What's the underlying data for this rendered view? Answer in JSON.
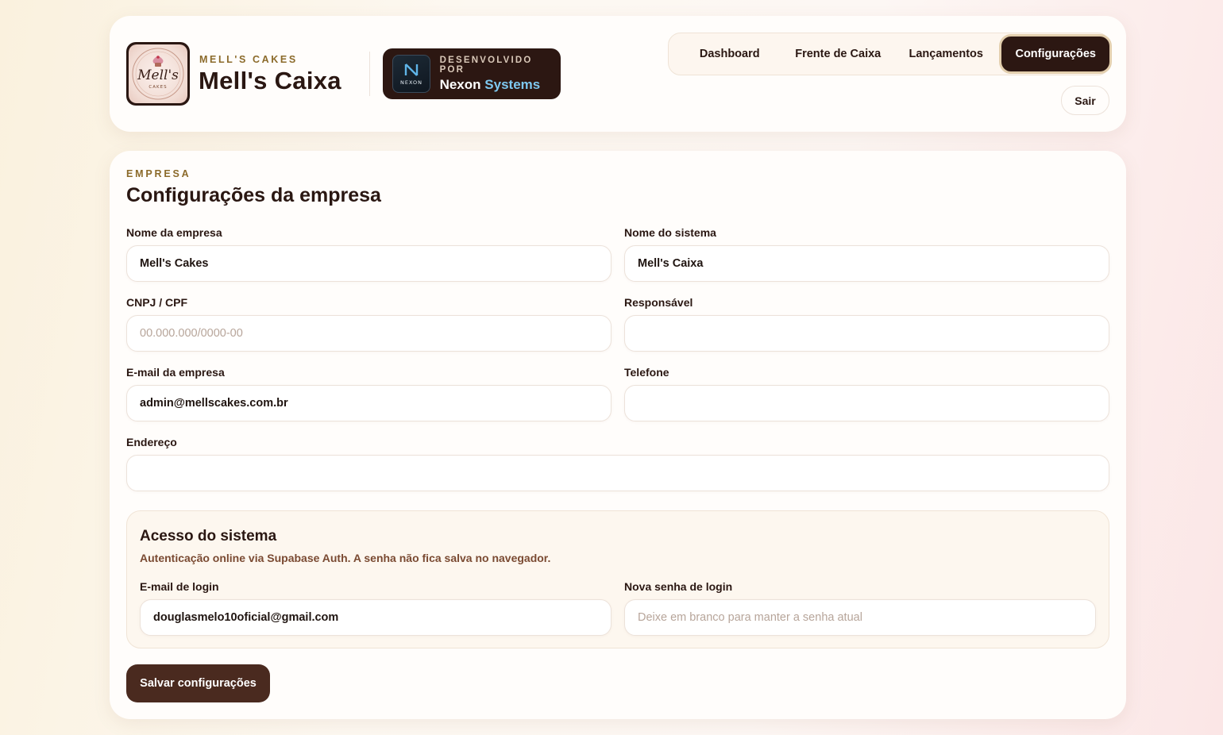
{
  "header": {
    "brand_kicker": "MELL'S CAKES",
    "brand_title": "Mell's Caixa",
    "logo_text": "Mell's",
    "logo_subtext": "CAKES",
    "dev_kicker": "DESENVOLVIDO POR",
    "dev_name_main": "Nexon",
    "dev_name_accent": "Systems",
    "dev_logo_letter": "N",
    "dev_logo_text": "NEXON"
  },
  "nav": {
    "items": [
      {
        "label": "Dashboard"
      },
      {
        "label": "Frente de Caixa"
      },
      {
        "label": "Lançamentos"
      },
      {
        "label": "Configurações"
      }
    ],
    "active": "Configurações",
    "logout_label": "Sair"
  },
  "settings": {
    "kicker": "EMPRESA",
    "title": "Configurações da empresa",
    "fields": {
      "company_name": {
        "label": "Nome da empresa",
        "value": "Mell's Cakes",
        "placeholder": ""
      },
      "system_name": {
        "label": "Nome do sistema",
        "value": "Mell's Caixa",
        "placeholder": ""
      },
      "document": {
        "label": "CNPJ / CPF",
        "value": "",
        "placeholder": "00.000.000/0000-00"
      },
      "responsible": {
        "label": "Responsável",
        "value": "",
        "placeholder": ""
      },
      "email": {
        "label": "E-mail da empresa",
        "value": "admin@mellscakes.com.br",
        "placeholder": ""
      },
      "phone": {
        "label": "Telefone",
        "value": "",
        "placeholder": ""
      },
      "address": {
        "label": "Endereço",
        "value": "",
        "placeholder": ""
      }
    },
    "access": {
      "title": "Acesso do sistema",
      "description": "Autenticação online via Supabase Auth. A senha não fica salva no navegador.",
      "login_email": {
        "label": "E-mail de login",
        "value": "douglasmelo10oficial@gmail.com",
        "placeholder": ""
      },
      "new_password": {
        "label": "Nova senha de login",
        "value": "",
        "placeholder": "Deixe em branco para manter a senha atual"
      }
    },
    "save_label": "Salvar configurações"
  },
  "colors": {
    "primary_dark": "#2c1712",
    "accent_gold": "#8b6a2a",
    "save_button": "#4a2a1f",
    "nexon_accent": "#7ec8f0"
  }
}
